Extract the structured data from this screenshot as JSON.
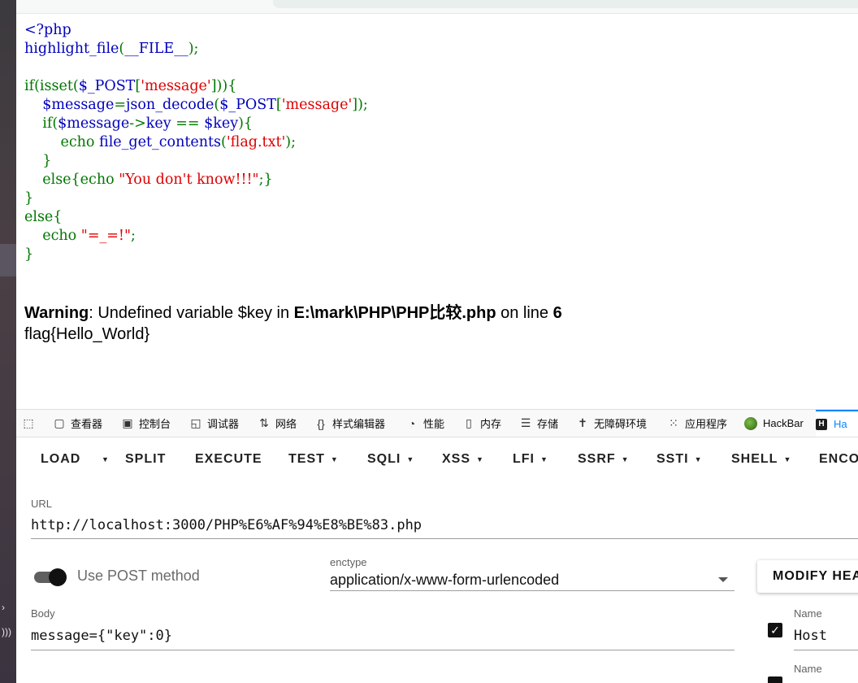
{
  "source_code": {
    "lines": [
      [
        {
          "t": "<?php",
          "c": "k"
        }
      ],
      [
        {
          "t": "highlight_file",
          "c": "k"
        },
        {
          "t": "(",
          "c": "d"
        },
        {
          "t": "__FILE__",
          "c": "k"
        },
        {
          "t": ");",
          "c": "d"
        }
      ],
      [],
      [
        {
          "t": "if(isset(",
          "c": "d"
        },
        {
          "t": "$_POST",
          "c": "k"
        },
        {
          "t": "[",
          "c": "d"
        },
        {
          "t": "'message'",
          "c": "s"
        },
        {
          "t": "])){",
          "c": "d"
        }
      ],
      [
        {
          "t": "    ",
          "c": "d"
        },
        {
          "t": "$message",
          "c": "k"
        },
        {
          "t": "=",
          "c": "d"
        },
        {
          "t": "json_decode",
          "c": "k"
        },
        {
          "t": "(",
          "c": "d"
        },
        {
          "t": "$_POST",
          "c": "k"
        },
        {
          "t": "[",
          "c": "d"
        },
        {
          "t": "'message'",
          "c": "s"
        },
        {
          "t": "]);",
          "c": "d"
        }
      ],
      [
        {
          "t": "    if(",
          "c": "d"
        },
        {
          "t": "$message",
          "c": "k"
        },
        {
          "t": "->",
          "c": "d"
        },
        {
          "t": "key ",
          "c": "k"
        },
        {
          "t": "== ",
          "c": "d"
        },
        {
          "t": "$key",
          "c": "k"
        },
        {
          "t": "){",
          "c": "d"
        }
      ],
      [
        {
          "t": "        echo ",
          "c": "d"
        },
        {
          "t": "file_get_contents",
          "c": "k"
        },
        {
          "t": "(",
          "c": "d"
        },
        {
          "t": "'flag.txt'",
          "c": "s"
        },
        {
          "t": ");",
          "c": "d"
        }
      ],
      [
        {
          "t": "    }",
          "c": "d"
        }
      ],
      [
        {
          "t": "    else{echo ",
          "c": "d"
        },
        {
          "t": "\"You don't know!!!\"",
          "c": "s"
        },
        {
          "t": ";}",
          "c": "d"
        }
      ],
      [
        {
          "t": "}",
          "c": "d"
        }
      ],
      [
        {
          "t": "else{",
          "c": "d"
        }
      ],
      [
        {
          "t": "    echo ",
          "c": "d"
        },
        {
          "t": "\"=_=!\"",
          "c": "s"
        },
        {
          "t": ";",
          "c": "d"
        }
      ],
      [
        {
          "t": "}",
          "c": "d"
        }
      ]
    ]
  },
  "output": {
    "warning_label": "Warning",
    "warning_text": ": Undefined variable $key in ",
    "warning_path": "E:\\mark\\PHP\\PHP比较.php",
    "warning_line_text": " on line ",
    "warning_line_no": "6",
    "flag": "flag{Hello_World}"
  },
  "devtools_tabs": [
    {
      "label": "",
      "icon": "pick-element-icon",
      "glyph": "⬚"
    },
    {
      "label": "查看器",
      "icon": "inspector-icon",
      "glyph": "▢"
    },
    {
      "label": "控制台",
      "icon": "console-icon",
      "glyph": "▣"
    },
    {
      "label": "调试器",
      "icon": "debugger-icon",
      "glyph": "◱"
    },
    {
      "label": "网络",
      "icon": "network-icon",
      "glyph": "⇅"
    },
    {
      "label": "样式编辑器",
      "icon": "style-editor-icon",
      "glyph": "{}"
    },
    {
      "label": "性能",
      "icon": "performance-icon",
      "glyph": "◔"
    },
    {
      "label": "内存",
      "icon": "memory-icon",
      "glyph": "▯"
    },
    {
      "label": "存储",
      "icon": "storage-icon",
      "glyph": "☰"
    },
    {
      "label": "无障碍环境",
      "icon": "accessibility-icon",
      "glyph": "✝"
    },
    {
      "label": "应用程序",
      "icon": "application-icon",
      "glyph": "⁙"
    },
    {
      "label": "HackBar",
      "icon": "hackbar-extension-icon",
      "glyph": ""
    },
    {
      "label": "Ha",
      "icon": "hackbar-icon",
      "glyph": "H",
      "active": true
    }
  ],
  "hackbar": {
    "buttons": [
      {
        "label": "LOAD",
        "caret": false
      },
      {
        "label": "",
        "caret": true
      },
      {
        "label": "SPLIT",
        "caret": false
      },
      {
        "label": "EXECUTE",
        "caret": false
      },
      {
        "label": "TEST",
        "caret": true
      },
      {
        "label": "SQLI",
        "caret": true
      },
      {
        "label": "XSS",
        "caret": true
      },
      {
        "label": "LFI",
        "caret": true
      },
      {
        "label": "SSRF",
        "caret": true
      },
      {
        "label": "SSTI",
        "caret": true
      },
      {
        "label": "SHELL",
        "caret": true
      },
      {
        "label": "ENCO",
        "caret": false
      }
    ],
    "url_label": "URL",
    "url_value": "http://localhost:3000/PHP%E6%AF%94%E8%BE%83.php",
    "post_toggle_label": "Use POST method",
    "post_enabled": true,
    "enctype_label": "enctype",
    "enctype_value": "application/x-www-form-urlencoded",
    "modify_headers_label": "MODIFY HEA",
    "body_label": "Body",
    "body_value": "message={\"key\":0}",
    "headers": [
      {
        "name_label": "Name",
        "value": "Host",
        "checked": true
      },
      {
        "name_label": "Name",
        "value": "",
        "checked": true
      }
    ]
  }
}
